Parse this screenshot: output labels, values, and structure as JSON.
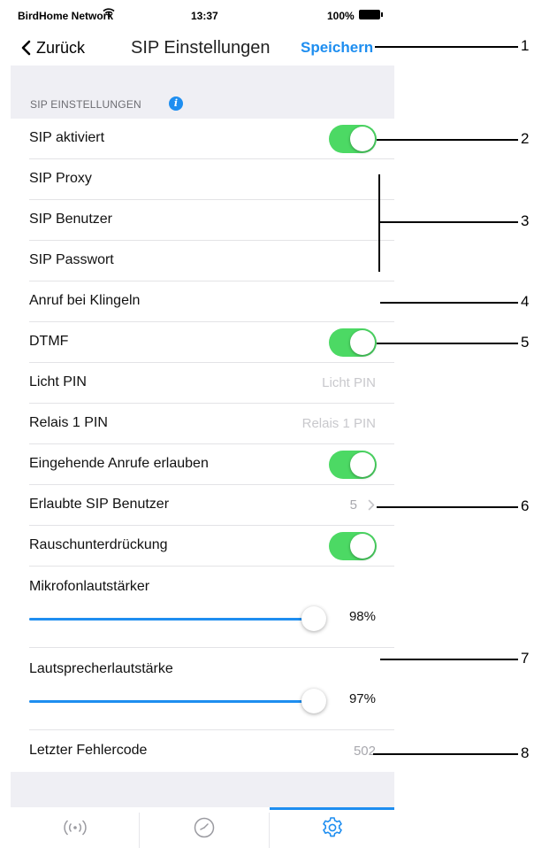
{
  "status_bar": {
    "carrier": "BirdHome Network",
    "time": "13:37",
    "battery": "100%"
  },
  "nav": {
    "back_label": "Zurück",
    "title": "SIP Einstellungen",
    "save_label": "Speichern"
  },
  "section": {
    "header": "SIP EINSTELLUNGEN"
  },
  "rows": {
    "sip_enabled": {
      "label": "SIP aktiviert",
      "on": true
    },
    "sip_proxy": {
      "label": "SIP Proxy"
    },
    "sip_user": {
      "label": "SIP Benutzer"
    },
    "sip_password": {
      "label": "SIP Passwort"
    },
    "ring_call": {
      "label": "Anruf bei Klingeln"
    },
    "dtmf": {
      "label": "DTMF",
      "on": true
    },
    "light_pin": {
      "label": "Licht PIN",
      "placeholder": "Licht PIN"
    },
    "relay_pin": {
      "label": "Relais 1 PIN",
      "placeholder": "Relais 1 PIN"
    },
    "incoming_calls": {
      "label": "Eingehende Anrufe erlauben",
      "on": true
    },
    "allowed_users": {
      "label": "Erlaubte SIP Benutzer",
      "value": "5"
    },
    "noise_suppression": {
      "label": "Rauschunterdrückung",
      "on": true
    },
    "mic_volume": {
      "label": "Mikrofonlautstärker",
      "value_text": "98%",
      "level": 0.98
    },
    "speaker_volume": {
      "label": "Lautsprecherlautstärke",
      "value_text": "97%",
      "level": 0.97
    },
    "last_error": {
      "label": "Letzter Fehlercode",
      "value": "502"
    }
  },
  "tabs": [
    {
      "icon": "broadcast-icon",
      "active": false
    },
    {
      "icon": "clock-icon",
      "active": false
    },
    {
      "icon": "gear-icon",
      "active": true
    }
  ],
  "colors": {
    "accent": "#1e8ef0",
    "toggle_on": "#4cd964",
    "group_background": "#efeff4"
  },
  "callouts": [
    "1",
    "2",
    "3",
    "4",
    "5",
    "6",
    "7",
    "8"
  ]
}
